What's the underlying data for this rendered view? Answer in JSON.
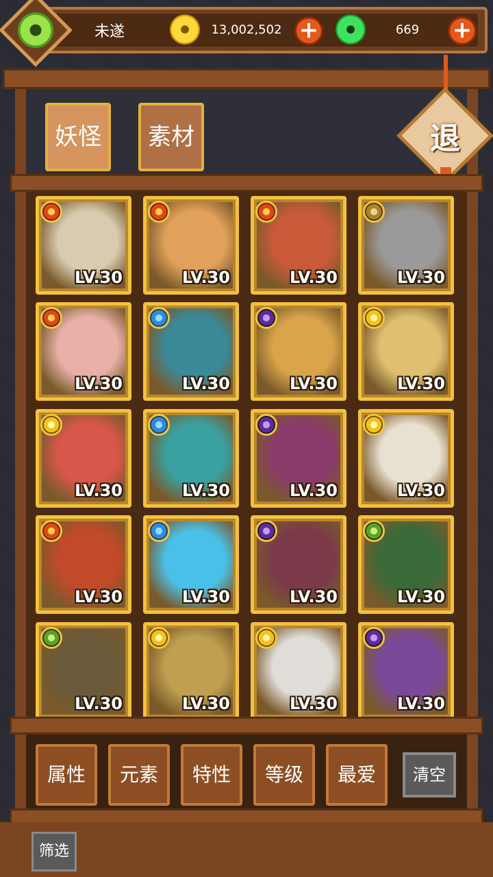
{
  "header": {
    "player_name": "未遂",
    "coins": "13,002,502",
    "jade": "669"
  },
  "tabs": [
    {
      "label": "妖怪",
      "active": true
    },
    {
      "label": "素材",
      "active": false
    }
  ],
  "exit_label": "退",
  "monsters": [
    {
      "element": "fire",
      "level": "LV.30",
      "color": "#d8cbb0"
    },
    {
      "element": "fire",
      "level": "LV.30",
      "color": "#e2a15a"
    },
    {
      "element": "fire",
      "level": "LV.30",
      "color": "#c85a3a"
    },
    {
      "element": "earth",
      "level": "LV.30",
      "color": "#9a9a9a"
    },
    {
      "element": "fire",
      "level": "LV.30",
      "color": "#e8b0a8"
    },
    {
      "element": "water",
      "level": "LV.30",
      "color": "#3a8a9a"
    },
    {
      "element": "dark",
      "level": "LV.30",
      "color": "#d9a44a"
    },
    {
      "element": "light",
      "level": "LV.30",
      "color": "#e0c070"
    },
    {
      "element": "light",
      "level": "LV.30",
      "color": "#d8574a"
    },
    {
      "element": "water",
      "level": "LV.30",
      "color": "#3aa0a0"
    },
    {
      "element": "dark",
      "level": "LV.30",
      "color": "#8a3a6a"
    },
    {
      "element": "light",
      "level": "LV.30",
      "color": "#e8e0d0"
    },
    {
      "element": "fire",
      "level": "LV.30",
      "color": "#c04a2a"
    },
    {
      "element": "water",
      "level": "LV.30",
      "color": "#4ac0e8"
    },
    {
      "element": "dark",
      "level": "LV.30",
      "color": "#7a3a4a"
    },
    {
      "element": "wood",
      "level": "LV.30",
      "color": "#3a6a3a"
    },
    {
      "element": "wood",
      "level": "LV.30",
      "color": "#6a5a3a"
    },
    {
      "element": "light",
      "level": "LV.30",
      "color": "#c0a050"
    },
    {
      "element": "light",
      "level": "LV.30",
      "color": "#e0dcd8"
    },
    {
      "element": "dark",
      "level": "LV.30",
      "color": "#7a4a9a"
    }
  ],
  "filters": [
    "属性",
    "元素",
    "特性",
    "等级",
    "最爱"
  ],
  "clear_label": "清空",
  "screen_label": "筛选"
}
